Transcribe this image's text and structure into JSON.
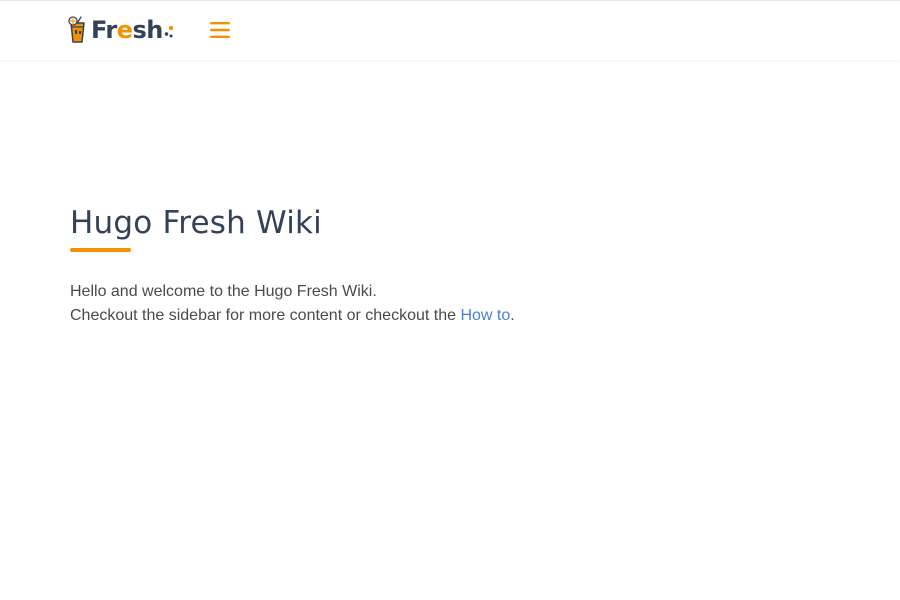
{
  "navbar": {
    "logo": {
      "text_plain_1": "Fr",
      "text_accent": "e",
      "text_plain_2": "sh",
      "icon": "juice-glass-icon",
      "brand_color": "#344258",
      "accent_color": "#F39200"
    },
    "menu_icon": "hamburger-menu-icon",
    "menu_icon_color": "#F39200"
  },
  "main": {
    "title": "Hugo Fresh Wiki",
    "welcome_line": "Hello and welcome to the Hugo Fresh Wiki.",
    "checkout_prefix": "Checkout the sidebar for more content or checkout the ",
    "howto_link": "How to",
    "checkout_suffix": ".",
    "link_color": "#4A7FD6",
    "underline_color": "#F39200"
  }
}
